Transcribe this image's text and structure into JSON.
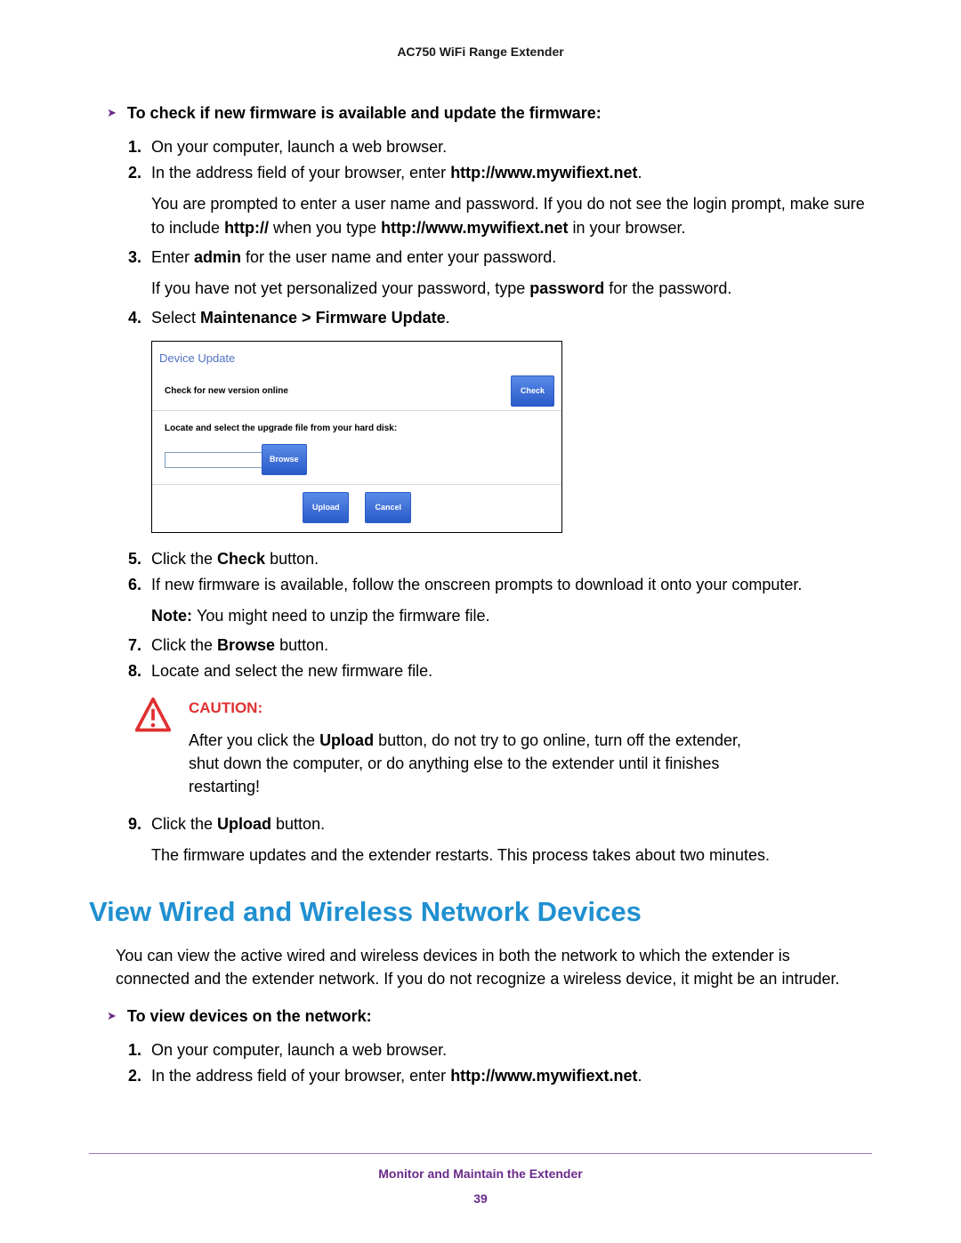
{
  "header": "AC750 WiFi Range Extender",
  "task1": {
    "title": "To check if new firmware is available and update the firmware:"
  },
  "steps1": {
    "s1": {
      "num": "1.",
      "text": "On your computer, launch a web browser."
    },
    "s2": {
      "num": "2.",
      "text_a": "In the address field of your browser, enter ",
      "text_b": "http://www.mywifiext.net",
      "text_c": ".",
      "para_a": "You are prompted to enter a user name and password. If you do not see the login prompt, make sure to include ",
      "para_b": "http://",
      "para_c": " when you type ",
      "para_d": "http://www.mywifiext.net",
      "para_e": " in your browser."
    },
    "s3": {
      "num": "3.",
      "text_a": "Enter ",
      "text_b": "admin",
      "text_c": " for the user name and enter your password.",
      "para_a": "If you have not yet personalized your password, type ",
      "para_b": "password",
      "para_c": " for the password."
    },
    "s4": {
      "num": "4.",
      "text_a": "Select ",
      "text_b": "Maintenance > Firmware Update",
      "text_c": "."
    },
    "s5": {
      "num": "5.",
      "text_a": "Click the ",
      "text_b": "Check",
      "text_c": " button."
    },
    "s6": {
      "num": "6.",
      "text": "If new firmware is available, follow the onscreen prompts to download it onto your computer."
    },
    "note": {
      "label": "Note:  ",
      "text": "You might need to unzip the firmware file."
    },
    "s7": {
      "num": "7.",
      "text_a": "Click the ",
      "text_b": "Browse",
      "text_c": " button."
    },
    "s8": {
      "num": "8.",
      "text": "Locate and select the new firmware file."
    },
    "s9": {
      "num": "9.",
      "text_a": "Click the ",
      "text_b": "Upload",
      "text_c": " button.",
      "para": "The firmware updates and the extender restarts. This process takes about two minutes."
    }
  },
  "screenshot": {
    "title": "Device Update",
    "check_label": "Check for new version online",
    "check_btn": "Check",
    "locate_label": "Locate and select the upgrade file from your hard disk:",
    "browse_btn": "Browse",
    "upload_btn": "Upload",
    "cancel_btn": "Cancel"
  },
  "caution": {
    "title": "CAUTION:",
    "text_a": "After you click the ",
    "text_b": "Upload",
    "text_c": " button, do not try to go online, turn off the extender, shut down the computer, or do anything else to the extender until it finishes restarting!"
  },
  "section_heading": "View Wired and Wireless Network Devices",
  "section_para": "You can view the active wired and wireless devices in both the network to which the extender is connected and the extender network. If you do not recognize a wireless device, it might be an intruder.",
  "task2": {
    "title": "To view devices on the network:"
  },
  "steps2": {
    "s1": {
      "num": "1.",
      "text": "On your computer, launch a web browser."
    },
    "s2": {
      "num": "2.",
      "text_a": "In the address field of your browser, enter ",
      "text_b": "http://www.mywifiext.net",
      "text_c": "."
    }
  },
  "footer": {
    "title": "Monitor and Maintain the Extender",
    "page": "39"
  }
}
